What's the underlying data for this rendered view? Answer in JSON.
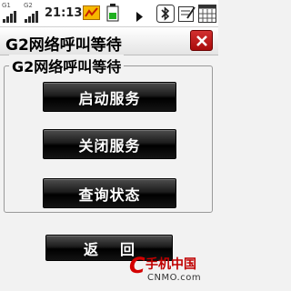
{
  "status_bar": {
    "signal_1_label": "G1",
    "signal_2_label": "G2",
    "time": "21:13",
    "icons": [
      "g1-signal-icon",
      "g2-signal-icon",
      "data-transfer-icon",
      "battery-icon",
      "play-arrow-icon",
      "bluetooth-icon",
      "note-icon",
      "calendar-icon"
    ]
  },
  "window": {
    "title": "G2网络呼叫等待",
    "close_icon": "close-icon"
  },
  "group": {
    "label": "G2网络呼叫等待",
    "buttons": {
      "activate": "启动服务",
      "deactivate": "关闭服务",
      "query": "查询状态"
    }
  },
  "footer": {
    "back_label": "返回"
  },
  "watermark": {
    "name": "手机中国",
    "url": "CNMO.com"
  },
  "colors": {
    "button_bg": "#000000",
    "button_text": "#ffffff",
    "close_red": "#c21d1d",
    "watermark_red": "#d40000"
  }
}
